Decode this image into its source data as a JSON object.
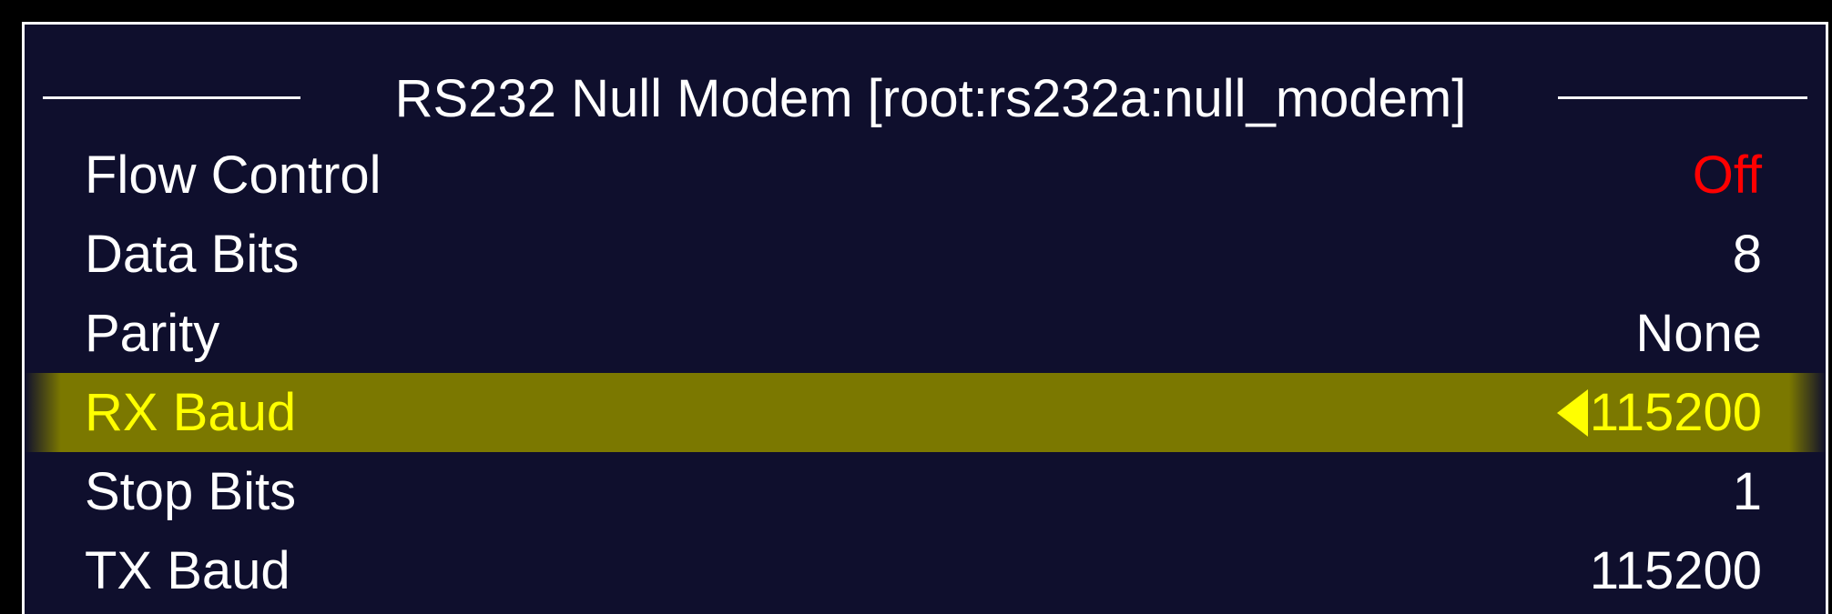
{
  "menu": {
    "title": "RS232 Null Modem [root:rs232a:null_modem]",
    "items": [
      {
        "label": "Flow Control",
        "value": "Off"
      },
      {
        "label": "Data Bits",
        "value": "8"
      },
      {
        "label": "Parity",
        "value": "None"
      },
      {
        "label": "RX Baud",
        "value": "115200",
        "selected": true
      },
      {
        "label": "Stop Bits",
        "value": "1"
      },
      {
        "label": "TX Baud",
        "value": "115200"
      }
    ]
  },
  "colors": {
    "background": "#0f0f2d",
    "text": "#ffffff",
    "selected_text": "#ffff00",
    "selected_highlight": "#7b7800",
    "off_value": "#ff0000"
  },
  "icons": {
    "selection_indicator": "left-triangle-icon"
  }
}
